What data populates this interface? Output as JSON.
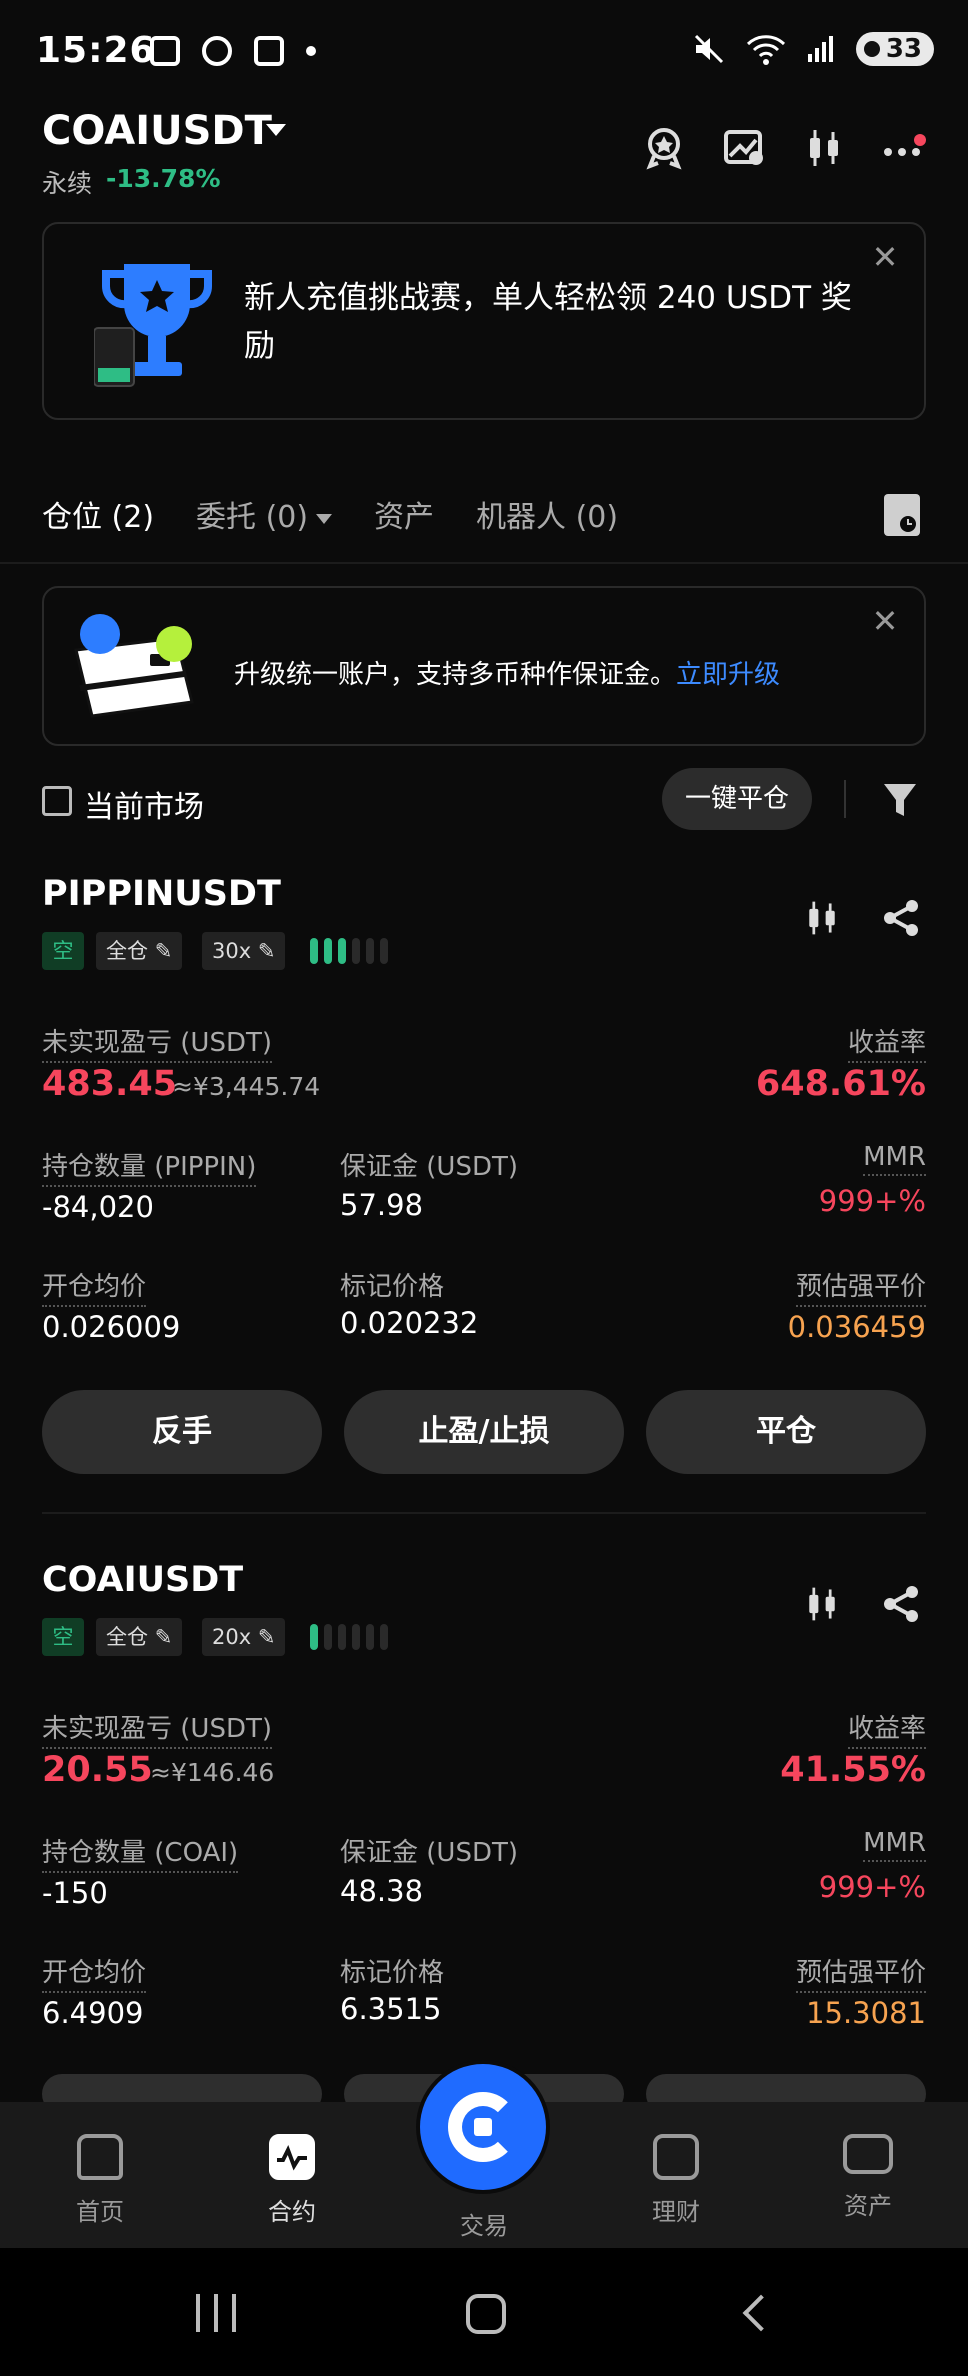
{
  "status_bar": {
    "time": "15:26",
    "battery": "33"
  },
  "header": {
    "pair": "COAIUSDT",
    "sub_label": "永续",
    "change": "-13.78%"
  },
  "promo": {
    "text": "新人充值挑战赛，单人轻松领 240 USDT 奖励"
  },
  "tabs": [
    {
      "label": "仓位 (2)"
    },
    {
      "label": "委托 (0)"
    },
    {
      "label": "资产"
    },
    {
      "label": "机器人 (0)"
    }
  ],
  "upgrade": {
    "text": "升级统一账户，支持多币种作保证金。",
    "link": "立即升级"
  },
  "filter": {
    "current_market": "当前市场",
    "close_all": "一键平仓"
  },
  "positions": [
    {
      "symbol": "PIPPINUSDT",
      "side": "空",
      "margin_mode": "全仓",
      "leverage": "30x",
      "risk_level": 3,
      "pnl_label": "未实现盈亏 (USDT)",
      "pnl": "483.45",
      "pnl_cny": "≈¥3,445.74",
      "roe_label": "收益率",
      "roe": "648.61%",
      "qty_label": "持仓数量 (PIPPIN)",
      "qty": "-84,020",
      "margin_label": "保证金 (USDT)",
      "margin": "57.98",
      "mmr_label": "MMR",
      "mmr": "999+%",
      "entry_label": "开仓均价",
      "entry": "0.026009",
      "mark_label": "标记价格",
      "mark": "0.020232",
      "liq_label": "预估强平价",
      "liq": "0.036459",
      "buttons": [
        "反手",
        "止盈/止损",
        "平仓"
      ]
    },
    {
      "symbol": "COAIUSDT",
      "side": "空",
      "margin_mode": "全仓",
      "leverage": "20x",
      "risk_level": 1,
      "pnl_label": "未实现盈亏 (USDT)",
      "pnl": "20.55",
      "pnl_cny": "≈¥146.46",
      "roe_label": "收益率",
      "roe": "41.55%",
      "qty_label": "持仓数量 (COAI)",
      "qty": "-150",
      "margin_label": "保证金 (USDT)",
      "margin": "48.38",
      "mmr_label": "MMR",
      "mmr": "999+%",
      "entry_label": "开仓均价",
      "entry": "6.4909",
      "mark_label": "标记价格",
      "mark": "6.3515",
      "liq_label": "预估强平价",
      "liq": "15.3081"
    }
  ],
  "bottom_nav": [
    {
      "label": "首页",
      "icon": "home-icon"
    },
    {
      "label": "合约",
      "icon": "futures-icon"
    },
    {
      "label": "交易",
      "icon": "trade-icon"
    },
    {
      "label": "理财",
      "icon": "earn-icon"
    },
    {
      "label": "资产",
      "icon": "wallet-icon"
    }
  ],
  "colors": {
    "up": "#2ebd85",
    "down": "#f6465d",
    "liq": "#f7a350",
    "link": "#3d8bff",
    "fab": "#1f6bff"
  }
}
